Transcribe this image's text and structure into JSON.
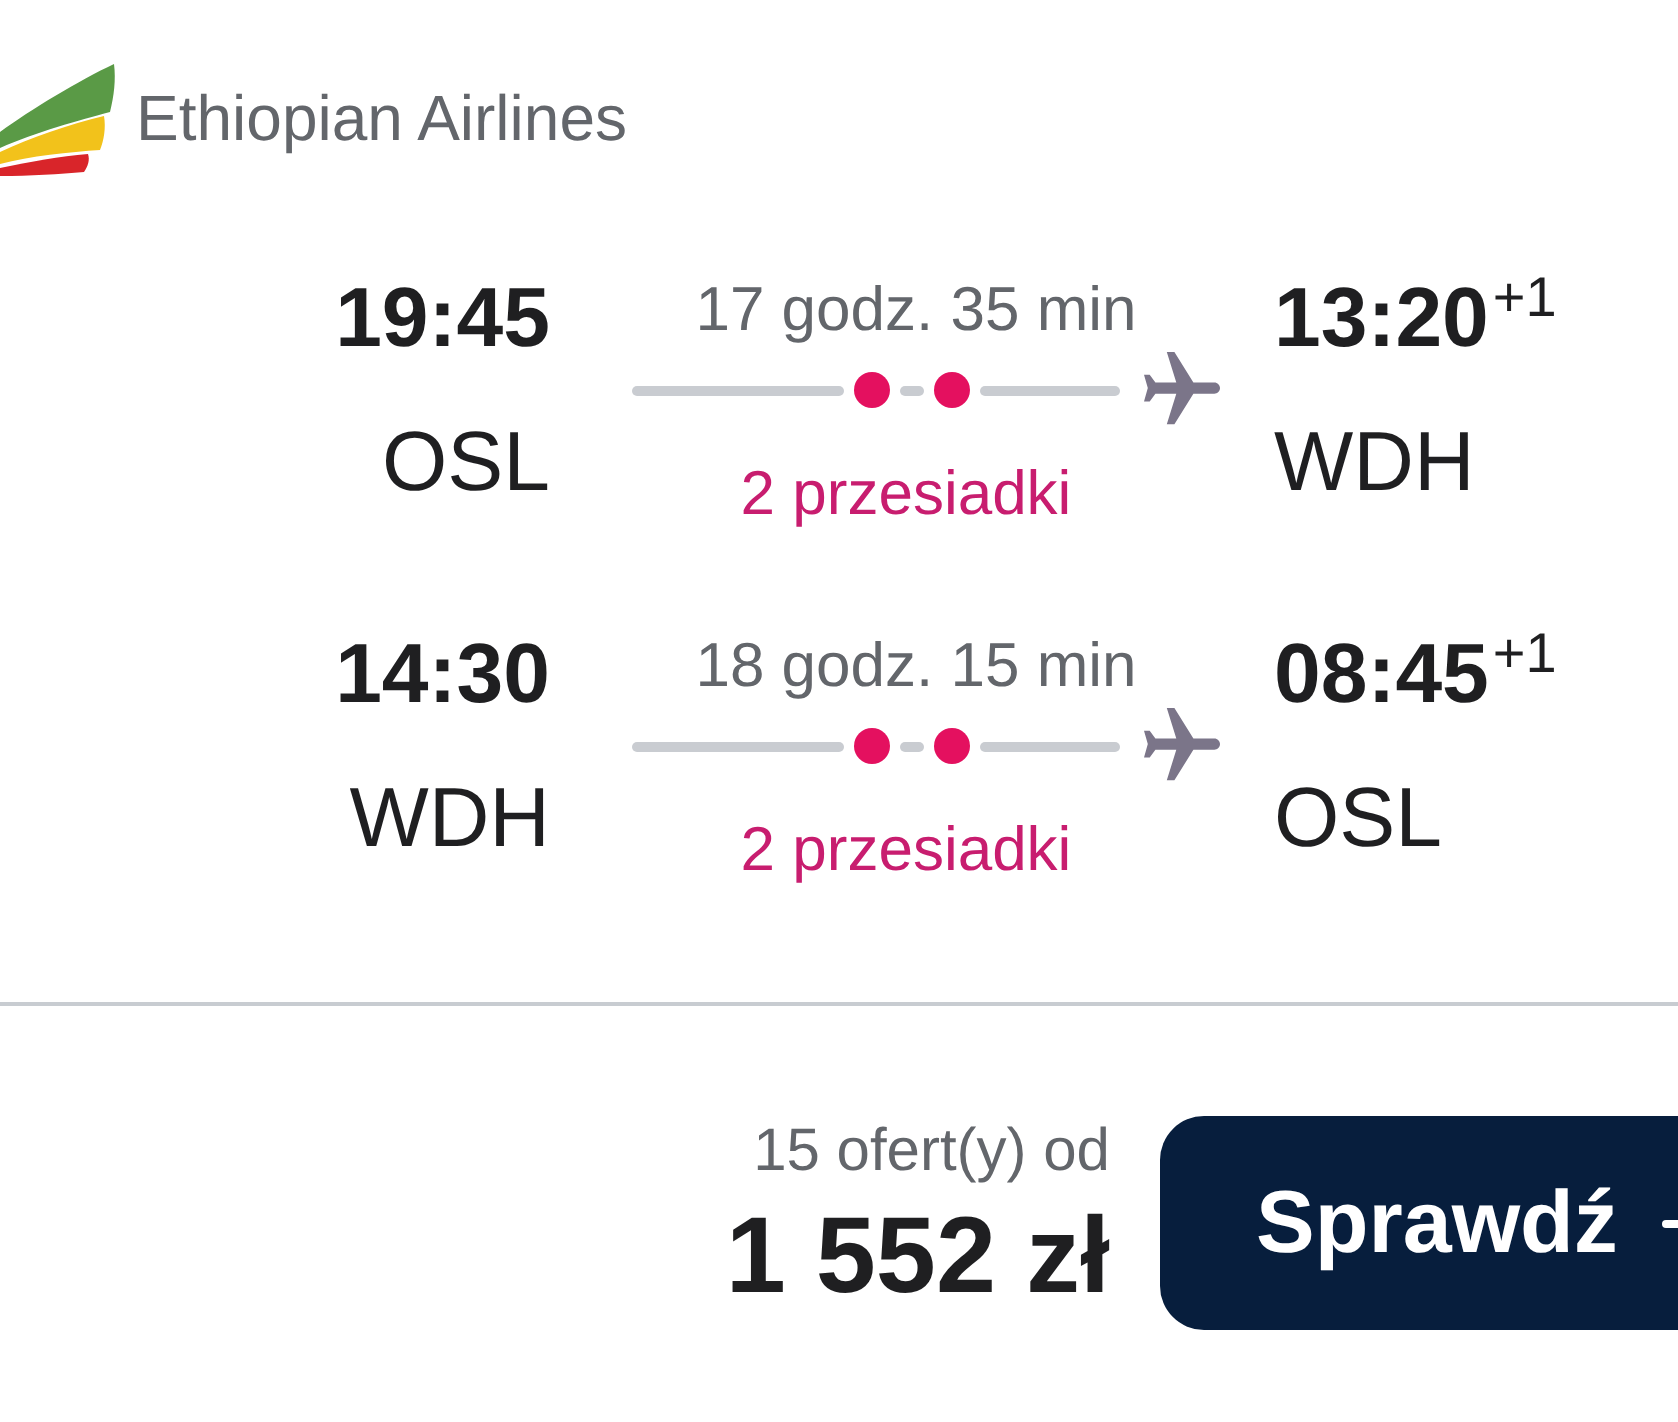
{
  "airline": {
    "name": "Ethiopian Airlines"
  },
  "flights": [
    {
      "departure": {
        "time": "19:45",
        "airport": "OSL"
      },
      "duration": "17 godz. 35 min",
      "stops": "2 przesiadki",
      "arrival": {
        "time": "13:20",
        "day_offset": "+1",
        "airport": "WDH"
      }
    },
    {
      "departure": {
        "time": "14:30",
        "airport": "WDH"
      },
      "duration": "18 godz. 15 min",
      "stops": "2 przesiadki",
      "arrival": {
        "time": "08:45",
        "day_offset": "+1",
        "airport": "OSL"
      }
    }
  ],
  "offer": {
    "count": "15 ofert(y) od",
    "price": "1 552 zł"
  },
  "button": {
    "label": "Sprawdź"
  }
}
